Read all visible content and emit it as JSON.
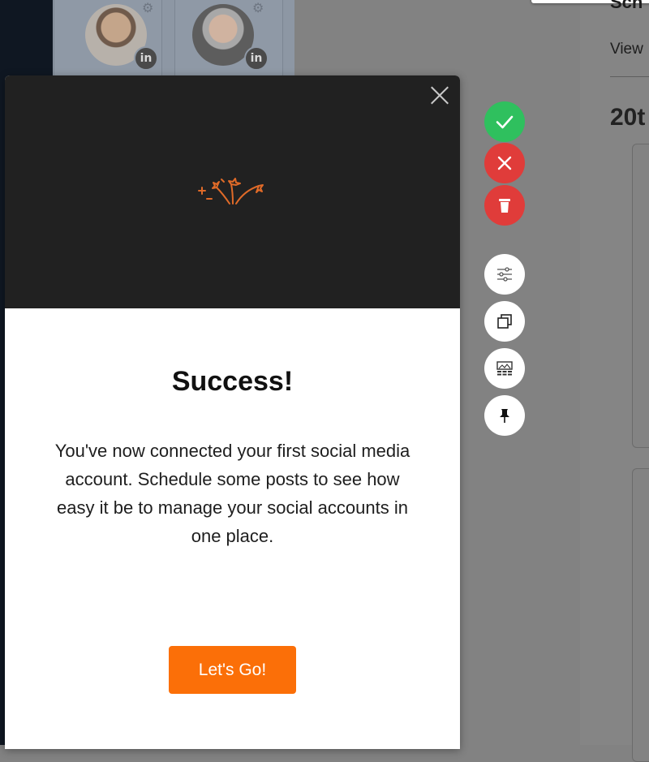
{
  "background": {
    "heading": "Sch",
    "view_link": "View",
    "date_heading": "20t"
  },
  "modal": {
    "title": "Success!",
    "message": "You've now connected your first social media account. Schedule some posts to see how easy it be to manage your social accounts in one place.",
    "cta_label": "Let's Go!",
    "accent_color": "#fb6f08"
  },
  "side_actions": [
    {
      "name": "approve",
      "icon": "check-icon",
      "color": "#2fc05e"
    },
    {
      "name": "reject",
      "icon": "close-icon",
      "color": "#e03c3a"
    },
    {
      "name": "delete",
      "icon": "trash-icon",
      "color": "#e03c3a"
    },
    {
      "name": "filters",
      "icon": "sliders-icon",
      "color": "#ffffff"
    },
    {
      "name": "duplicate",
      "icon": "copy-icon",
      "color": "#ffffff"
    },
    {
      "name": "media",
      "icon": "image-grid-icon",
      "color": "#ffffff"
    },
    {
      "name": "pin",
      "icon": "pin-icon",
      "color": "#ffffff"
    }
  ],
  "profile_avatars": [
    {
      "network": "LinkedIn",
      "badge": "in"
    },
    {
      "network": "LinkedIn",
      "badge": "in"
    }
  ]
}
